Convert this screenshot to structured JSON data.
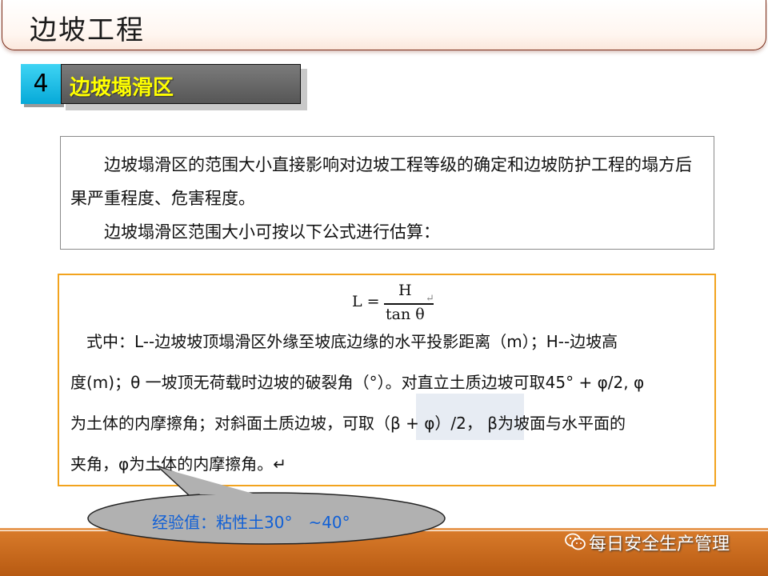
{
  "header": {
    "title": "边坡工程"
  },
  "section": {
    "number": "4",
    "title": "边坡塌滑区"
  },
  "intro": {
    "p1": "边坡塌滑区的范围大小直接影响对边坡工程等级的确定和边坡防护工程的塌方后果严重程度、危害程度。",
    "p2": "边坡塌滑区范围大小可按以下公式进行估算："
  },
  "formula": {
    "lhs": "L =",
    "numerator": "H",
    "denominator": "tan θ",
    "mark": "↵"
  },
  "explanation": {
    "line1": "　式中：L--边坡坡顶塌滑区外缘至坡底边缘的水平投影距离（m）；H--边坡高",
    "line2": "度(m)；θ 一坡顶无荷载时边坡的破裂角（°）。对直立土质边坡可取45° + φ/2, φ",
    "line3": "为土体的内摩擦角；对斜面土质边坡，可取（β + φ）/2， β为坡面与水平面的",
    "line4": "夹角，φ为土体的内摩擦角。↵"
  },
  "callout": {
    "text": "经验值：粘性土30°　~40°"
  },
  "footer": {
    "brand": "每日安全生产管理"
  },
  "colors": {
    "accent_orange": "#f2a31e",
    "section_yellow": "#ffff00",
    "callout_text": "#0f5fd6",
    "footer_band": "#c9671d"
  }
}
